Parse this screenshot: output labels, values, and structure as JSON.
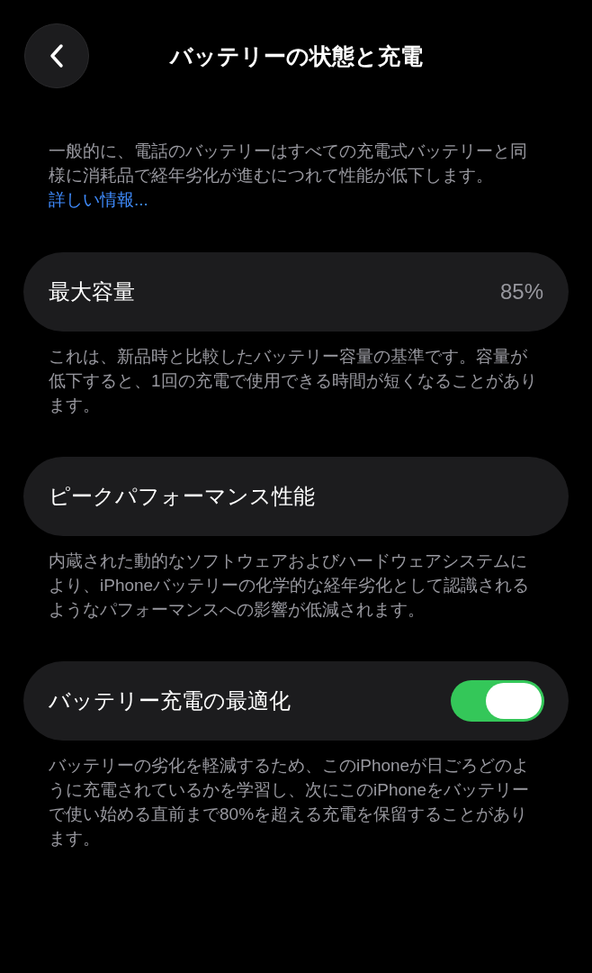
{
  "header": {
    "title": "バッテリーの状態と充電"
  },
  "intro": {
    "text": "一般的に、電話のバッテリーはすべての充電式バッテリーと同様に消耗品で経年劣化が進むにつれて性能が低下します。",
    "link": "詳しい情報..."
  },
  "sections": [
    {
      "kind": "value",
      "label": "最大容量",
      "value": "85%",
      "footer": "これは、新品時と比較したバッテリー容量の基準です。容量が低下すると、1回の充電で使用できる時間が短くなることがあります。"
    },
    {
      "kind": "plain",
      "label": "ピークパフォーマンス性能",
      "footer": "内蔵された動的なソフトウェアおよびハードウェアシステムにより、iPhoneバッテリーの化学的な経年劣化として認識されるようなパフォーマンスへの影響が低減されます。"
    },
    {
      "kind": "toggle",
      "label": "バッテリー充電の最適化",
      "on": true,
      "footer": "バッテリーの劣化を軽減するため、このiPhoneが日ごろどのように充電されているかを学習し、次にこのiPhoneをバッテリーで使い始める直前まで80%を超える充電を保留することがあります。"
    }
  ]
}
